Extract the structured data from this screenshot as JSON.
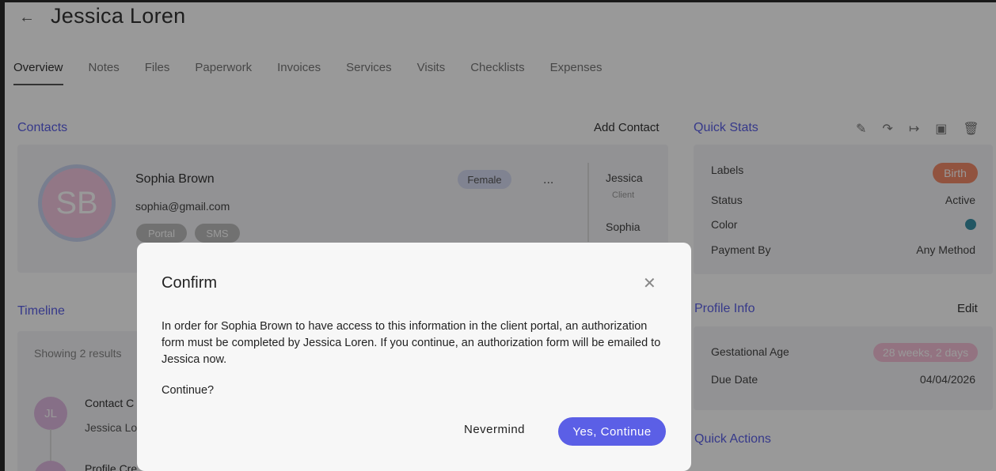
{
  "header": {
    "back_icon": "arrow-left-icon",
    "title": "Jessica Loren"
  },
  "tabs": [
    {
      "label": "Overview",
      "active": true
    },
    {
      "label": "Notes"
    },
    {
      "label": "Files"
    },
    {
      "label": "Paperwork"
    },
    {
      "label": "Invoices"
    },
    {
      "label": "Services"
    },
    {
      "label": "Visits"
    },
    {
      "label": "Checklists"
    },
    {
      "label": "Expenses"
    }
  ],
  "contacts": {
    "heading": "Contacts",
    "add_label": "Add Contact",
    "contact": {
      "initials": "SB",
      "name": "Sophia Brown",
      "email": "sophia@gmail.com",
      "gender": "Female",
      "tags": [
        "Portal",
        "SMS"
      ],
      "more": "..."
    },
    "side_list": [
      {
        "name": "Jessica",
        "role": "Client"
      },
      {
        "name": "Sophia"
      }
    ]
  },
  "quick_stats": {
    "heading": "Quick Stats",
    "icons": [
      "pencil-icon",
      "share-icon",
      "arrow-right-icon",
      "archive-icon",
      "trash-icon"
    ],
    "labels_label": "Labels",
    "labels_value": "Birth",
    "status_label": "Status",
    "status_value": "Active",
    "color_label": "Color",
    "color_value": "#3a8fa6",
    "payment_label": "Payment By",
    "payment_value": "Any Method"
  },
  "profile_info": {
    "heading": "Profile Info",
    "edit_label": "Edit",
    "ga_label": "Gestational Age",
    "ga_value": "28 weeks, 2 days",
    "due_label": "Due Date",
    "due_value": "04/04/2026"
  },
  "quick_actions": {
    "heading": "Quick Actions"
  },
  "timeline": {
    "heading": "Timeline",
    "showing": "Showing 2 results",
    "items": [
      {
        "initials": "JL",
        "title": "Contact C",
        "subtitle": "Jessica Lo"
      },
      {
        "title": "Profile Cre"
      }
    ]
  },
  "modal": {
    "title": "Confirm",
    "close_icon": "close-icon",
    "body": "In order for Sophia Brown to have access to this information in the client portal, an authorization form must be completed by Jessica Loren. If you continue, an authorization form will be emailed to Jessica now.",
    "question": "Continue?",
    "cancel_label": "Nevermind",
    "confirm_label": "Yes, Continue"
  },
  "colors": {
    "accent": "#5b5fe6",
    "birth": "#f28a6a"
  }
}
